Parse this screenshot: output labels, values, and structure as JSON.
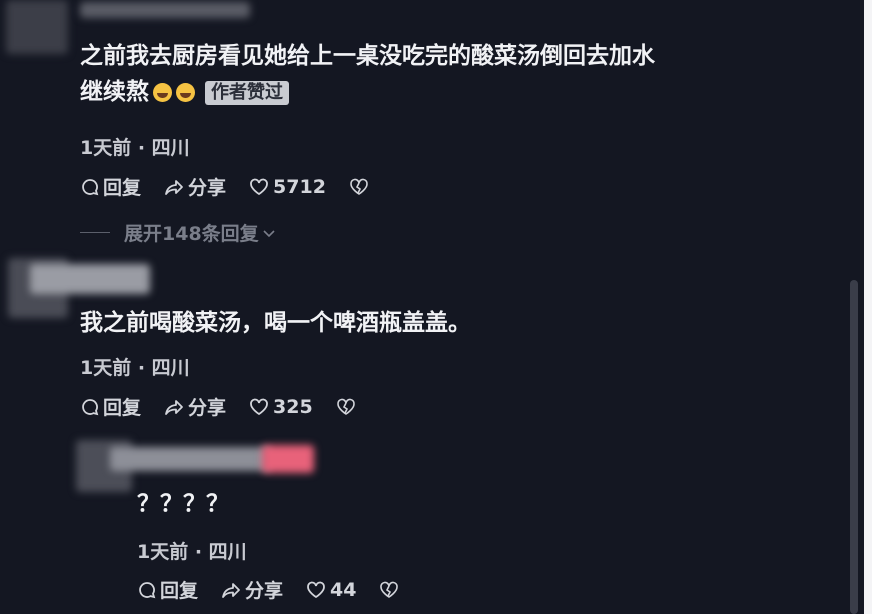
{
  "comments": [
    {
      "text_line1": "之前我去厨房看见她给上一桌没吃完的酸菜汤倒回去加水",
      "text_line2": "继续熬",
      "badge": "作者赞过",
      "meta": "1天前 · 四川",
      "reply_label": "回复",
      "share_label": "分享",
      "likes": "5712",
      "expand_label": "展开148条回复"
    },
    {
      "text": "我之前喝酸菜汤，喝一个啤酒瓶盖盖。",
      "meta": "1天前 · 四川",
      "reply_label": "回复",
      "share_label": "分享",
      "likes": "325"
    },
    {
      "text": "？？？？",
      "meta": "1天前 · 四川",
      "reply_label": "回复",
      "share_label": "分享",
      "likes": "44"
    }
  ],
  "colors": {
    "background": "#141722",
    "text": "#f1f2f5",
    "badge_bg": "#c9cbd1",
    "muted": "#7a7e8a"
  }
}
